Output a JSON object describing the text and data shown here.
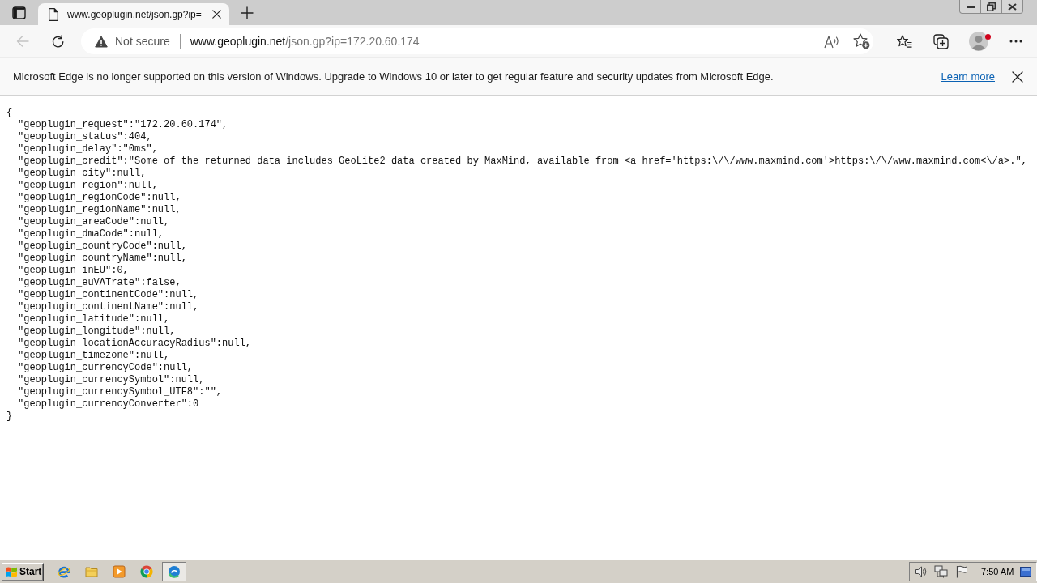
{
  "tabs": [
    {
      "title": "www.geoplugin.net/json.gp?ip=",
      "selected": true
    }
  ],
  "toolbar": {
    "back": {
      "disabled": true
    },
    "security_label": "Not secure",
    "url": {
      "host": "www.geoplugin.net",
      "path": "/json.gp?ip=172.20.60.174"
    }
  },
  "infobar": {
    "message": "Microsoft Edge is no longer supported on this version of Windows. Upgrade to Windows 10 or later to get regular feature and security updates from Microsoft Edge.",
    "link": "Learn more"
  },
  "document": {
    "open": "{",
    "entries": [
      "\"geoplugin_request\":\"172.20.60.174\",",
      "\"geoplugin_status\":404,",
      "\"geoplugin_delay\":\"0ms\",",
      "\"geoplugin_credit\":\"Some of the returned data includes GeoLite2 data created by MaxMind, available from <a href='https:\\/\\/www.maxmind.com'>https:\\/\\/www.maxmind.com<\\/a>.\",",
      "\"geoplugin_city\":null,",
      "\"geoplugin_region\":null,",
      "\"geoplugin_regionCode\":null,",
      "\"geoplugin_regionName\":null,",
      "\"geoplugin_areaCode\":null,",
      "\"geoplugin_dmaCode\":null,",
      "\"geoplugin_countryCode\":null,",
      "\"geoplugin_countryName\":null,",
      "\"geoplugin_inEU\":0,",
      "\"geoplugin_euVATrate\":false,",
      "\"geoplugin_continentCode\":null,",
      "\"geoplugin_continentName\":null,",
      "\"geoplugin_latitude\":null,",
      "\"geoplugin_longitude\":null,",
      "\"geoplugin_locationAccuracyRadius\":null,",
      "\"geoplugin_timezone\":null,",
      "\"geoplugin_currencyCode\":null,",
      "\"geoplugin_currencySymbol\":null,",
      "\"geoplugin_currencySymbol_UTF8\":\"\",",
      "\"geoplugin_currencyConverter\":0"
    ],
    "close": "}"
  },
  "taskbar": {
    "start": "Start",
    "apps": [
      {
        "kind": "ie",
        "selected": false
      },
      {
        "kind": "folder",
        "selected": false
      },
      {
        "kind": "media",
        "selected": false
      },
      {
        "kind": "chrome",
        "selected": false
      },
      {
        "kind": "edge",
        "selected": true
      }
    ],
    "clock": "7:50 AM"
  }
}
